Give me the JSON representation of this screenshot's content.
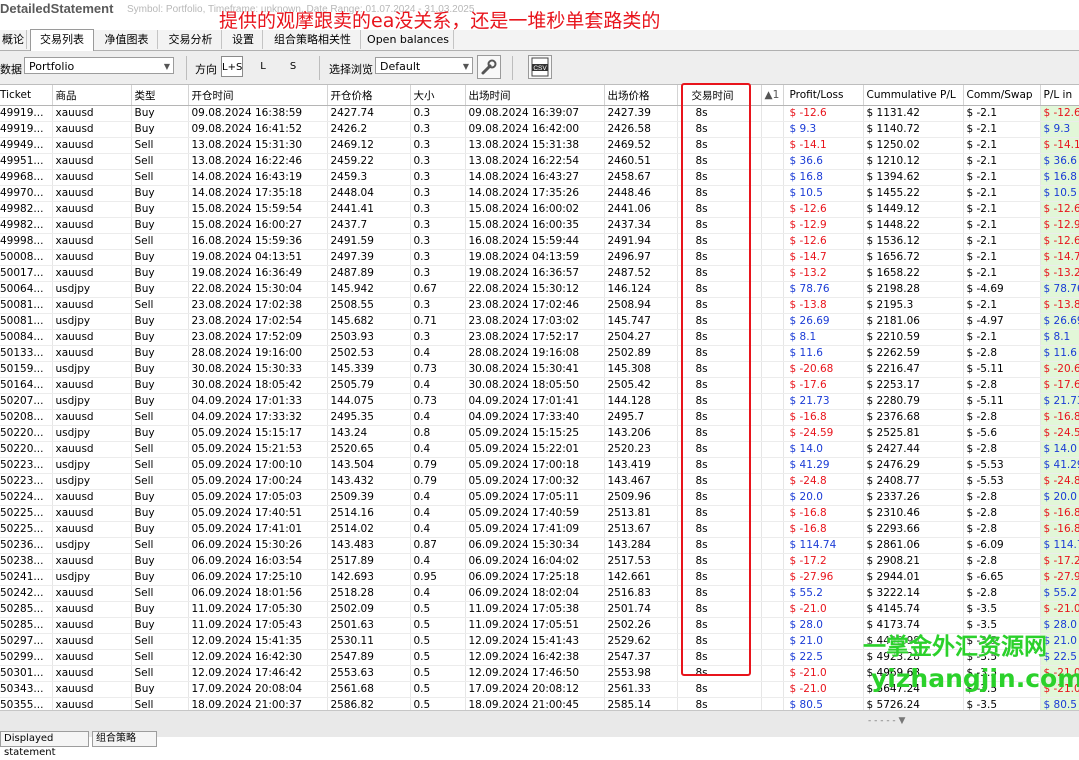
{
  "window": {
    "title": "DetailedStatement",
    "subtitle": "Symbol: Portfolio, Timeframe: unknown, Date Range: 01.07.2024 - 31.03.2025"
  },
  "annotation": "提供的观摩跟卖的ea没关系，还是一堆秒单套路类的",
  "tabs": [
    "概论",
    "交易列表",
    "净值图表",
    "交易分析",
    "设置",
    "组合策略相关性",
    "Open balances"
  ],
  "toolbar": {
    "data_label": "数据",
    "portfolio_value": "Portfolio",
    "direction_label": "方向",
    "direction_options": [
      "L+S",
      "L",
      "S"
    ],
    "browse_label": "选择浏览",
    "browse_value": "Default",
    "csv_label": "CSV"
  },
  "grid": {
    "headers": [
      "Ticket",
      "商品",
      "类型",
      "开仓时间",
      "开仓价格",
      "大小",
      "出场时间",
      "出场价格",
      "交易时间",
      "▲1",
      "Profit/Loss",
      "Cummulative P/L",
      "Comm/Swap",
      "P/L in"
    ],
    "rows": [
      [
        "49919...",
        "xauusd",
        "Buy",
        "09.08.2024 16:38:59",
        "2427.74",
        "0.3",
        "09.08.2024 16:39:07",
        "2427.39",
        "8s",
        "",
        "$ -12.6",
        "$ 1131.42",
        "$ -2.1",
        "$ -12.6"
      ],
      [
        "49919...",
        "xauusd",
        "Buy",
        "09.08.2024 16:41:52",
        "2426.2",
        "0.3",
        "09.08.2024 16:42:00",
        "2426.58",
        "8s",
        "",
        "$ 9.3",
        "$ 1140.72",
        "$ -2.1",
        "$ 9.3"
      ],
      [
        "49949...",
        "xauusd",
        "Sell",
        "13.08.2024 15:31:30",
        "2469.12",
        "0.3",
        "13.08.2024 15:31:38",
        "2469.52",
        "8s",
        "",
        "$ -14.1",
        "$ 1250.02",
        "$ -2.1",
        "$ -14.1"
      ],
      [
        "49951...",
        "xauusd",
        "Sell",
        "13.08.2024 16:22:46",
        "2459.22",
        "0.3",
        "13.08.2024 16:22:54",
        "2460.51",
        "8s",
        "",
        "$ 36.6",
        "$ 1210.12",
        "$ -2.1",
        "$ 36.6"
      ],
      [
        "49968...",
        "xauusd",
        "Sell",
        "14.08.2024 16:43:19",
        "2459.3",
        "0.3",
        "14.08.2024 16:43:27",
        "2458.67",
        "8s",
        "",
        "$ 16.8",
        "$ 1394.62",
        "$ -2.1",
        "$ 16.8"
      ],
      [
        "49970...",
        "xauusd",
        "Buy",
        "14.08.2024 17:35:18",
        "2448.04",
        "0.3",
        "14.08.2024 17:35:26",
        "2448.46",
        "8s",
        "",
        "$ 10.5",
        "$ 1455.22",
        "$ -2.1",
        "$ 10.5"
      ],
      [
        "49982...",
        "xauusd",
        "Buy",
        "15.08.2024 15:59:54",
        "2441.41",
        "0.3",
        "15.08.2024 16:00:02",
        "2441.06",
        "8s",
        "",
        "$ -12.6",
        "$ 1449.12",
        "$ -2.1",
        "$ -12.6"
      ],
      [
        "49982...",
        "xauusd",
        "Buy",
        "15.08.2024 16:00:27",
        "2437.7",
        "0.3",
        "15.08.2024 16:00:35",
        "2437.34",
        "8s",
        "",
        "$ -12.9",
        "$ 1448.22",
        "$ -2.1",
        "$ -12.9"
      ],
      [
        "49998...",
        "xauusd",
        "Sell",
        "16.08.2024 15:59:36",
        "2491.59",
        "0.3",
        "16.08.2024 15:59:44",
        "2491.94",
        "8s",
        "",
        "$ -12.6",
        "$ 1536.12",
        "$ -2.1",
        "$ -12.6"
      ],
      [
        "50008...",
        "xauusd",
        "Buy",
        "19.08.2024 04:13:51",
        "2497.39",
        "0.3",
        "19.08.2024 04:13:59",
        "2496.97",
        "8s",
        "",
        "$ -14.7",
        "$ 1656.72",
        "$ -2.1",
        "$ -14.7"
      ],
      [
        "50017...",
        "xauusd",
        "Buy",
        "19.08.2024 16:36:49",
        "2487.89",
        "0.3",
        "19.08.2024 16:36:57",
        "2487.52",
        "8s",
        "",
        "$ -13.2",
        "$ 1658.22",
        "$ -2.1",
        "$ -13.2"
      ],
      [
        "50064...",
        "usdjpy",
        "Buy",
        "22.08.2024 15:30:04",
        "145.942",
        "0.67",
        "22.08.2024 15:30:12",
        "146.124",
        "8s",
        "",
        "$ 78.76",
        "$ 2198.28",
        "$ -4.69",
        "$ 78.76"
      ],
      [
        "50081...",
        "xauusd",
        "Sell",
        "23.08.2024 17:02:38",
        "2508.55",
        "0.3",
        "23.08.2024 17:02:46",
        "2508.94",
        "8s",
        "",
        "$ -13.8",
        "$ 2195.3",
        "$ -2.1",
        "$ -13.8"
      ],
      [
        "50081...",
        "usdjpy",
        "Buy",
        "23.08.2024 17:02:54",
        "145.682",
        "0.71",
        "23.08.2024 17:03:02",
        "145.747",
        "8s",
        "",
        "$ 26.69",
        "$ 2181.06",
        "$ -4.97",
        "$ 26.69"
      ],
      [
        "50084...",
        "xauusd",
        "Buy",
        "23.08.2024 17:52:09",
        "2503.93",
        "0.3",
        "23.08.2024 17:52:17",
        "2504.27",
        "8s",
        "",
        "$ 8.1",
        "$ 2210.59",
        "$ -2.1",
        "$ 8.1"
      ],
      [
        "50133...",
        "xauusd",
        "Buy",
        "28.08.2024 19:16:00",
        "2502.53",
        "0.4",
        "28.08.2024 19:16:08",
        "2502.89",
        "8s",
        "",
        "$ 11.6",
        "$ 2262.59",
        "$ -2.8",
        "$ 11.6"
      ],
      [
        "50159...",
        "usdjpy",
        "Buy",
        "30.08.2024 15:30:33",
        "145.339",
        "0.73",
        "30.08.2024 15:30:41",
        "145.308",
        "8s",
        "",
        "$ -20.68",
        "$ 2216.47",
        "$ -5.11",
        "$ -20.68"
      ],
      [
        "50164...",
        "xauusd",
        "Buy",
        "30.08.2024 18:05:42",
        "2505.79",
        "0.4",
        "30.08.2024 18:05:50",
        "2505.42",
        "8s",
        "",
        "$ -17.6",
        "$ 2253.17",
        "$ -2.8",
        "$ -17.6"
      ],
      [
        "50207...",
        "usdjpy",
        "Buy",
        "04.09.2024 17:01:33",
        "144.075",
        "0.73",
        "04.09.2024 17:01:41",
        "144.128",
        "8s",
        "",
        "$ 21.73",
        "$ 2280.79",
        "$ -5.11",
        "$ 21.73"
      ],
      [
        "50208...",
        "xauusd",
        "Sell",
        "04.09.2024 17:33:32",
        "2495.35",
        "0.4",
        "04.09.2024 17:33:40",
        "2495.7",
        "8s",
        "",
        "$ -16.8",
        "$ 2376.68",
        "$ -2.8",
        "$ -16.8"
      ],
      [
        "50220...",
        "usdjpy",
        "Buy",
        "05.09.2024 15:15:17",
        "143.24",
        "0.8",
        "05.09.2024 15:15:25",
        "143.206",
        "8s",
        "",
        "$ -24.59",
        "$ 2525.81",
        "$ -5.6",
        "$ -24.59"
      ],
      [
        "50220...",
        "xauusd",
        "Sell",
        "05.09.2024 15:21:53",
        "2520.65",
        "0.4",
        "05.09.2024 15:22:01",
        "2520.23",
        "8s",
        "",
        "$ 14.0",
        "$ 2427.44",
        "$ -2.8",
        "$ 14.0"
      ],
      [
        "50223...",
        "usdjpy",
        "Sell",
        "05.09.2024 17:00:10",
        "143.504",
        "0.79",
        "05.09.2024 17:00:18",
        "143.419",
        "8s",
        "",
        "$ 41.29",
        "$ 2476.29",
        "$ -5.53",
        "$ 41.29"
      ],
      [
        "50223...",
        "usdjpy",
        "Sell",
        "05.09.2024 17:00:24",
        "143.432",
        "0.79",
        "05.09.2024 17:00:32",
        "143.467",
        "8s",
        "",
        "$ -24.8",
        "$ 2408.77",
        "$ -5.53",
        "$ -24.8"
      ],
      [
        "50224...",
        "xauusd",
        "Buy",
        "05.09.2024 17:05:03",
        "2509.39",
        "0.4",
        "05.09.2024 17:05:11",
        "2509.96",
        "8s",
        "",
        "$ 20.0",
        "$ 2337.26",
        "$ -2.8",
        "$ 20.0"
      ],
      [
        "50225...",
        "xauusd",
        "Buy",
        "05.09.2024 17:40:51",
        "2514.16",
        "0.4",
        "05.09.2024 17:40:59",
        "2513.81",
        "8s",
        "",
        "$ -16.8",
        "$ 2310.46",
        "$ -2.8",
        "$ -16.8"
      ],
      [
        "50225...",
        "xauusd",
        "Buy",
        "05.09.2024 17:41:01",
        "2514.02",
        "0.4",
        "05.09.2024 17:41:09",
        "2513.67",
        "8s",
        "",
        "$ -16.8",
        "$ 2293.66",
        "$ -2.8",
        "$ -16.8"
      ],
      [
        "50236...",
        "usdjpy",
        "Sell",
        "06.09.2024 15:30:26",
        "143.483",
        "0.87",
        "06.09.2024 15:30:34",
        "143.284",
        "8s",
        "",
        "$ 114.74",
        "$ 2861.06",
        "$ -6.09",
        "$ 114.74"
      ],
      [
        "50238...",
        "xauusd",
        "Buy",
        "06.09.2024 16:03:54",
        "2517.89",
        "0.4",
        "06.09.2024 16:04:02",
        "2517.53",
        "8s",
        "",
        "$ -17.2",
        "$ 2908.21",
        "$ -2.8",
        "$ -17.2"
      ],
      [
        "50241...",
        "usdjpy",
        "Buy",
        "06.09.2024 17:25:10",
        "142.693",
        "0.95",
        "06.09.2024 17:25:18",
        "142.661",
        "8s",
        "",
        "$ -27.96",
        "$ 2944.01",
        "$ -6.65",
        "$ -27.96"
      ],
      [
        "50242...",
        "xauusd",
        "Sell",
        "06.09.2024 18:01:56",
        "2518.28",
        "0.4",
        "06.09.2024 18:02:04",
        "2516.83",
        "8s",
        "",
        "$ 55.2",
        "$ 3222.14",
        "$ -2.8",
        "$ 55.2"
      ],
      [
        "50285...",
        "xauusd",
        "Buy",
        "11.09.2024 17:05:30",
        "2502.09",
        "0.5",
        "11.09.2024 17:05:38",
        "2501.74",
        "8s",
        "",
        "$ -21.0",
        "$ 4145.74",
        "$ -3.5",
        "$ -21.0"
      ],
      [
        "50285...",
        "xauusd",
        "Buy",
        "11.09.2024 17:05:43",
        "2501.63",
        "0.5",
        "11.09.2024 17:05:51",
        "2502.26",
        "8s",
        "",
        "$ 28.0",
        "$ 4173.74",
        "$ -3.5",
        "$ 28.0"
      ],
      [
        "50297...",
        "xauusd",
        "Sell",
        "12.09.2024 15:41:35",
        "2530.11",
        "0.5",
        "12.09.2024 15:41:43",
        "2529.62",
        "8s",
        "",
        "$ 21.0",
        "$ 4498.98",
        "$ -3.5",
        "$ 21.0"
      ],
      [
        "50299...",
        "xauusd",
        "Sell",
        "12.09.2024 16:42:30",
        "2547.89",
        "0.5",
        "12.09.2024 16:42:38",
        "2547.37",
        "8s",
        "",
        "$ 22.5",
        "$ 4923.28",
        "$ -3.5",
        "$ 22.5"
      ],
      [
        "50301...",
        "xauusd",
        "Sell",
        "12.09.2024 17:46:42",
        "2553.63",
        "0.5",
        "12.09.2024 17:46:50",
        "2553.98",
        "8s",
        "",
        "$ -21.0",
        "$ 4969.68",
        "$ -3.5",
        "$ -21.0"
      ],
      [
        "50343...",
        "xauusd",
        "Buy",
        "17.09.2024 20:08:04",
        "2561.68",
        "0.5",
        "17.09.2024 20:08:12",
        "2561.33",
        "8s",
        "",
        "$ -21.0",
        "$ 5647.24",
        "$ -3.5",
        "$ -21.0"
      ],
      [
        "50355...",
        "xauusd",
        "Sell",
        "18.09.2024 21:00:37",
        "2586.82",
        "0.5",
        "18.09.2024 21:00:45",
        "2585.14",
        "8s",
        "",
        "$ 80.5",
        "$ 5726.24",
        "$ -3.5",
        "$ 80.5"
      ]
    ]
  },
  "watermark": {
    "line1": "一掌金外汇资源网",
    "line2": "yizhangjin.com"
  },
  "bottom_tabs": [
    "Displayed statement",
    "组合策略"
  ],
  "scroll_hint": "- - - - -  ▼"
}
